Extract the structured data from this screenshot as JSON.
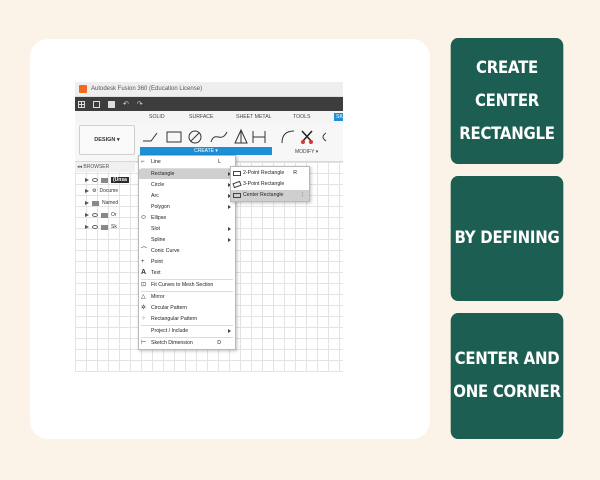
{
  "screenshot": {
    "title_bar": "Autodesk Fusion 360 (Education License)",
    "tabs": [
      "SOLID",
      "SURFACE",
      "SHEET METAL",
      "TOOLS",
      "SK"
    ],
    "design_button": "DESIGN ▾",
    "create_group": "CREATE ▾",
    "modify_group": "MODIFY ▾",
    "browser_header": "◂◂  BROWSER",
    "browser_rows": [
      "(Unsa",
      "Docume",
      "Named",
      "Or",
      "Sk"
    ],
    "create_menu": [
      {
        "label": "Line",
        "key": "L"
      },
      {
        "label": "Rectangle",
        "key": "",
        "submenu": true
      },
      {
        "label": "Circle",
        "key": "",
        "submenu": true
      },
      {
        "label": "Arc",
        "key": "",
        "submenu": true
      },
      {
        "label": "Polygon",
        "key": "",
        "submenu": true
      },
      {
        "label": "Ellipse",
        "key": ""
      },
      {
        "label": "Slot",
        "key": "",
        "submenu": true
      },
      {
        "label": "Spline",
        "key": "",
        "submenu": true
      },
      {
        "label": "Conic Curve",
        "key": ""
      },
      {
        "label": "Point",
        "key": ""
      },
      {
        "label": "Text",
        "key": ""
      },
      {
        "label": "Fit Curves to Mesh Section",
        "key": ""
      },
      {
        "label": "Mirror",
        "key": ""
      },
      {
        "label": "Circular Pattern",
        "key": ""
      },
      {
        "label": "Rectangular Pattern",
        "key": ""
      },
      {
        "label": "Project / Include",
        "key": "",
        "submenu": true
      },
      {
        "label": "Sketch Dimension",
        "key": "D"
      }
    ],
    "rectangle_submenu": [
      {
        "label": "2-Point Rectangle",
        "key": "R"
      },
      {
        "label": "3-Point Rectangle",
        "key": ""
      },
      {
        "label": "Center Rectangle",
        "key": "⋮"
      }
    ]
  },
  "panels": [
    {
      "lines": [
        "CREATE",
        "CENTER",
        "RECTANGLE"
      ]
    },
    {
      "lines": [
        "BY DEFINING"
      ]
    },
    {
      "lines": [
        "CENTER AND",
        "ONE CORNER"
      ]
    }
  ],
  "colors": {
    "background": "#fcf3e8",
    "panel": "#1c5e51",
    "accent_blue": "#1f8fd6"
  }
}
